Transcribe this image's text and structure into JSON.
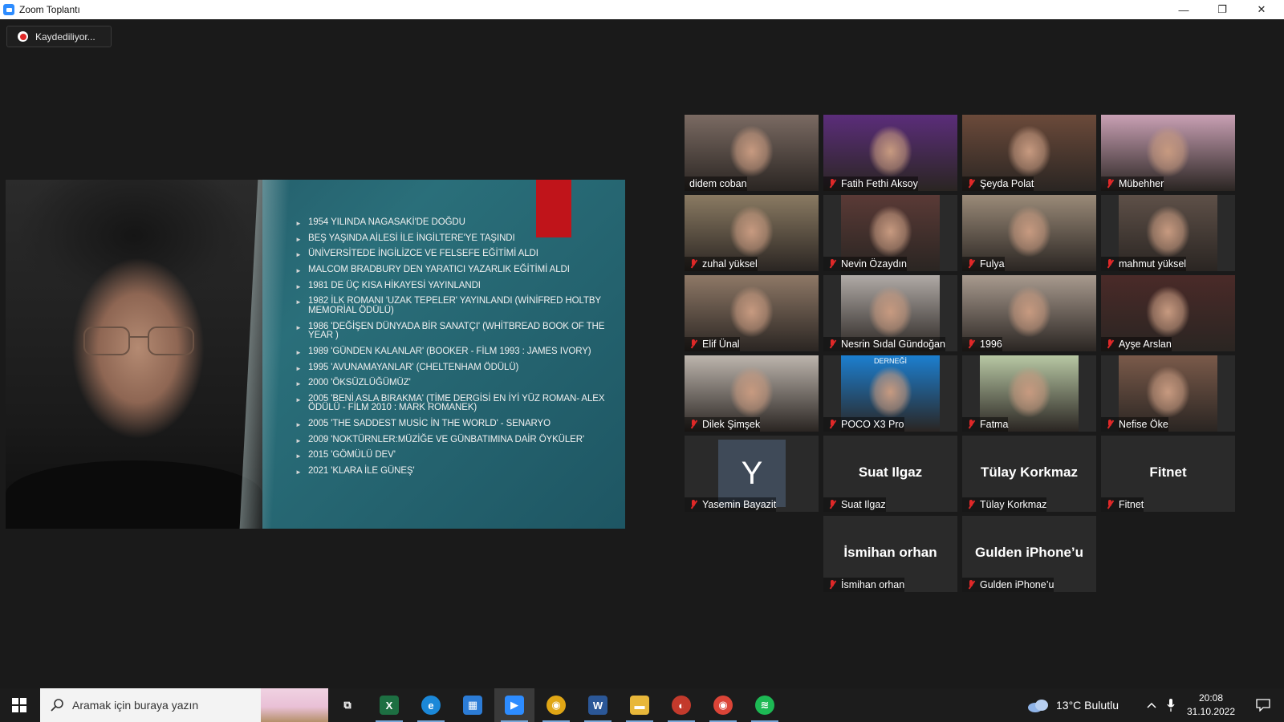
{
  "window": {
    "title": "Zoom Toplantı",
    "controls": {
      "minimize": "—",
      "maximize": "❐",
      "close": "✕"
    }
  },
  "recording": {
    "label": "Kaydediliyor..."
  },
  "slide": {
    "bullets": [
      "1954 YILINDA NAGASAKİ'DE DOĞDU",
      "BEŞ YAŞINDA AİLESİ İLE İNGİLTERE'YE TAŞINDI",
      "ÜNİVERSİTEDE İNGİLİZCE VE FELSEFE EĞİTİMİ ALDI",
      "MALCOM BRADBURY DEN YARATICI YAZARLIK EĞİTİMİ ALDI",
      "1981 DE ÜÇ KISA HİKAYESİ  YAYINLANDI",
      "1982 İLK ROMANI 'UZAK TEPELER' YAYINLANDI  (WİNİFRED HOLTBY MEMORİAL ÖDÜLÜ)",
      "1986 'DEĞİŞEN DÜNYADA BİR SANATÇI'  (WHİTBREAD BOOK OF THE YEAR )",
      "1989 'GÜNDEN KALANLAR'  (BOOKER - FİLM 1993 : JAMES IVORY)",
      "1995  'AVUNAMAYANLAR'   (CHELTENHAM ÖDÜLÜ)",
      "2000  'ÖKSÜZLÜĞÜMÜZ'",
      "2005  'BENİ ASLA BIRAKMA'  (TİME DERGİSİ EN İYİ YÜZ ROMAN- ALEX ÖDÜLÜ - FİLM 2010 : MARK ROMANEK)",
      "2005  'THE SADDEST MUSİC İN THE WORLD' - SENARYO",
      "2009 'NOKTÜRNLER:MÜZİĞE VE GÜNBATIMINA DAİR ÖYKÜLER'",
      "2015 'GÖMÜLÜ DEV'",
      "2021  'KLARA İLE GÜNEŞ'"
    ]
  },
  "participants": [
    {
      "name": "didem coban",
      "muted": false,
      "active": true,
      "bg": "#7a6a62"
    },
    {
      "name": "Fatih Fethi Aksoy",
      "muted": true,
      "bg": "#5b2d7a"
    },
    {
      "name": "Şeyda Polat",
      "muted": true,
      "bg": "#6b4a3a"
    },
    {
      "name": "Mübehher",
      "muted": true,
      "bg": "#c9a0b4"
    },
    {
      "name": "zuhal yüksel",
      "muted": true,
      "bg": "#8a7a62"
    },
    {
      "name": "Nevin Özaydın",
      "muted": true,
      "bg": "#5a3a36"
    },
    {
      "name": "Fulya",
      "muted": true,
      "bg": "#9a8a78"
    },
    {
      "name": "mahmut yüksel",
      "muted": true,
      "bg": "#5e5048"
    },
    {
      "name": "Elif Ünal",
      "muted": true,
      "bg": "#8e7866"
    },
    {
      "name": "Nesrin Sıdal Gündoğan",
      "muted": true,
      "bg": "#b0aaa6"
    },
    {
      "name": "1996",
      "muted": true,
      "bg": "#a89a8e"
    },
    {
      "name": "Ayşe Arslan",
      "muted": true,
      "bg": "#4a2a28"
    },
    {
      "name": "Dilek Şimşek",
      "muted": true,
      "bg": "#bdb5ad"
    },
    {
      "name": "POCO X3 Pro",
      "muted": true,
      "bg": "#1c7fd0",
      "caption": "DERNEĞİ"
    },
    {
      "name": "Fatma",
      "muted": true,
      "bg": "#b8c8a4"
    },
    {
      "name": "Nefise Öke",
      "muted": true,
      "bg": "#7a5a4a"
    },
    {
      "name": "Yasemin Bayazit",
      "muted": true,
      "avatar_letter": "Y"
    },
    {
      "name": "Suat Ilgaz",
      "muted": true,
      "big_label": "Suat Ilgaz"
    },
    {
      "name": "Tülay Korkmaz",
      "muted": true,
      "big_label": "Tülay Korkmaz"
    },
    {
      "name": "Fitnet",
      "muted": true,
      "big_label": "Fitnet"
    },
    {
      "name": "İsmihan orhan",
      "muted": true,
      "big_label": "İsmihan orhan"
    },
    {
      "name": "Gulden iPhone’u",
      "muted": true,
      "big_label": "Gulden iPhone’u"
    }
  ],
  "taskbar": {
    "search_placeholder": "Aramak için buraya yazın",
    "apps": [
      {
        "name": "task-view",
        "glyph": "⧉"
      },
      {
        "name": "excel",
        "glyph": "X",
        "color": "#1d6f42"
      },
      {
        "name": "edge",
        "glyph": "e",
        "color": "#1b88d8"
      },
      {
        "name": "microsoft-store",
        "glyph": "▦",
        "color": "#2c7cd6"
      },
      {
        "name": "zoom",
        "glyph": "▶",
        "color": "#2d8cff"
      },
      {
        "name": "chrome",
        "glyph": "◉",
        "color": "#e0a615"
      },
      {
        "name": "word",
        "glyph": "W",
        "color": "#2b5797"
      },
      {
        "name": "file-explorer",
        "glyph": "▬",
        "color": "#e8b73a"
      },
      {
        "name": "recorder",
        "glyph": "◐",
        "color": "#c33a2c"
      },
      {
        "name": "chrome-profile",
        "glyph": "◉",
        "color": "#db4437"
      },
      {
        "name": "spotify",
        "glyph": "≋",
        "color": "#1db954"
      }
    ],
    "weather": "13°C  Bulutlu",
    "time": "20:08",
    "date": "31.10.2022"
  }
}
